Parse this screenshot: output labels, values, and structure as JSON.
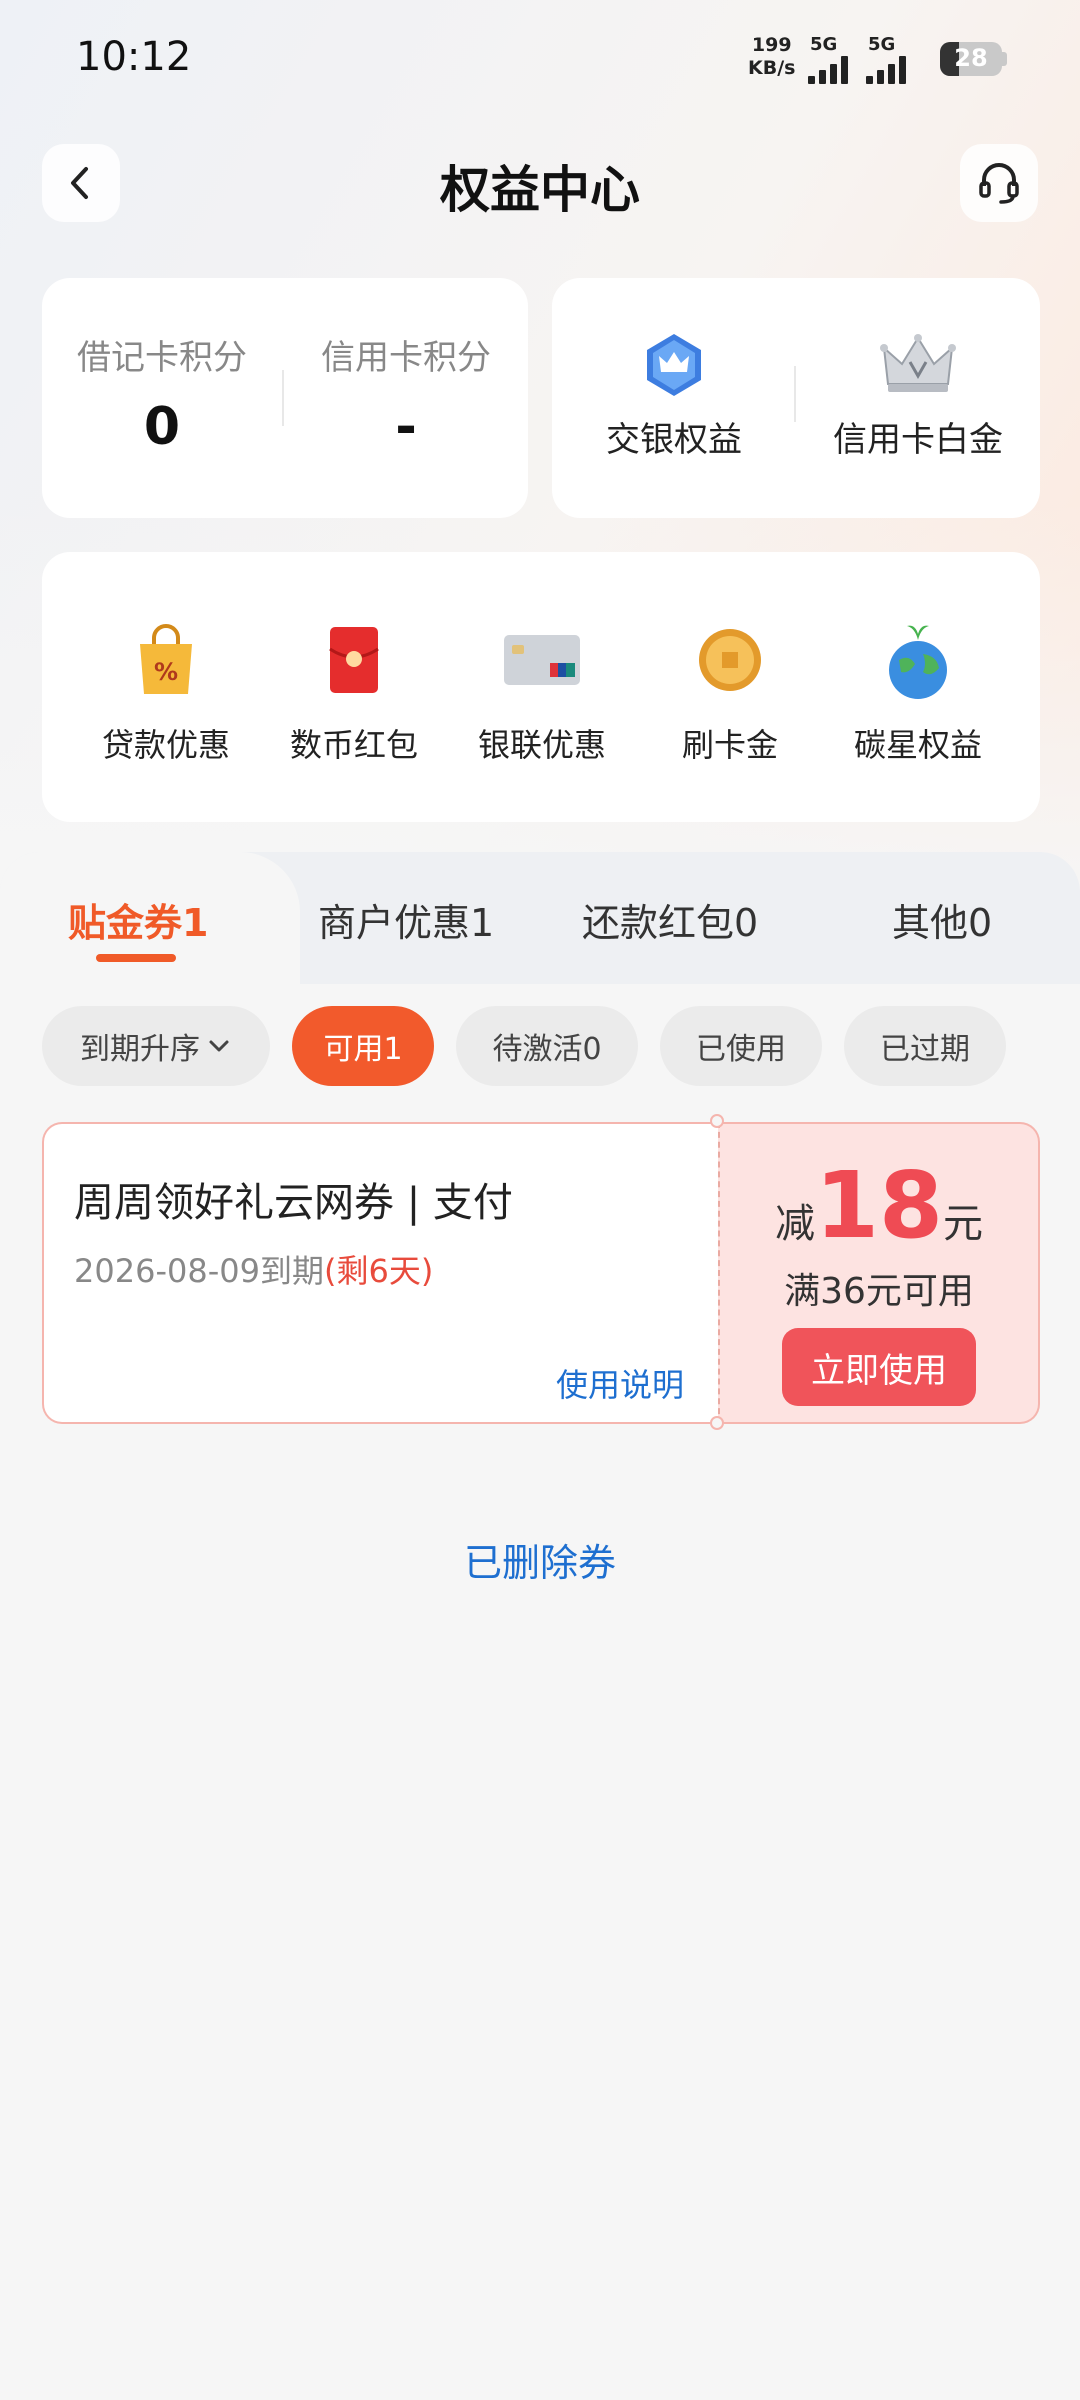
{
  "status_bar": {
    "time": "10:12",
    "net_speed_value": "199",
    "net_speed_unit": "KB/s",
    "signal1_label": "5G",
    "signal2_label": "5G",
    "battery": "28"
  },
  "header": {
    "title": "权益中心",
    "back_icon": "chevron-left-icon",
    "service_icon": "headset-icon"
  },
  "points": {
    "debit_label": "借记卡积分",
    "debit_value": "0",
    "credit_label": "信用卡积分",
    "credit_value": "-"
  },
  "benefits": [
    {
      "label": "交银权益",
      "icon": "crown-badge-icon"
    },
    {
      "label": "信用卡白金",
      "icon": "platinum-crown-icon"
    }
  ],
  "quick_links": [
    {
      "label": "贷款优惠",
      "icon": "discount-bag-icon"
    },
    {
      "label": "数币红包",
      "icon": "red-envelope-icon"
    },
    {
      "label": "银联优惠",
      "icon": "unionpay-card-icon"
    },
    {
      "label": "刷卡金",
      "icon": "gold-coin-icon"
    },
    {
      "label": "碳星权益",
      "icon": "earth-plant-icon"
    }
  ],
  "tabs": [
    {
      "label": "贴金券1",
      "active": true
    },
    {
      "label": "商户优惠1",
      "active": false
    },
    {
      "label": "还款红包0",
      "active": false
    },
    {
      "label": "其他0",
      "active": false
    }
  ],
  "filters": {
    "sort_label": "到期升序",
    "chips": [
      {
        "label": "可用1",
        "active": true
      },
      {
        "label": "待激活0",
        "active": false
      },
      {
        "label": "已使用",
        "active": false
      },
      {
        "label": "已过期",
        "active": false
      }
    ]
  },
  "coupon": {
    "title": "周周领好礼云网券 | 支付",
    "expiry": "2026-08-09到期",
    "remaining": "(剩6天)",
    "help_label": "使用说明",
    "amount_prefix": "减",
    "amount": "18",
    "amount_unit": "元",
    "condition": "满36元可用",
    "use_button": "立即使用"
  },
  "deleted_link": "已删除券",
  "colors": {
    "accent": "#f05a28",
    "coupon_red": "#ef4b54",
    "link_blue": "#1e6fd0"
  }
}
